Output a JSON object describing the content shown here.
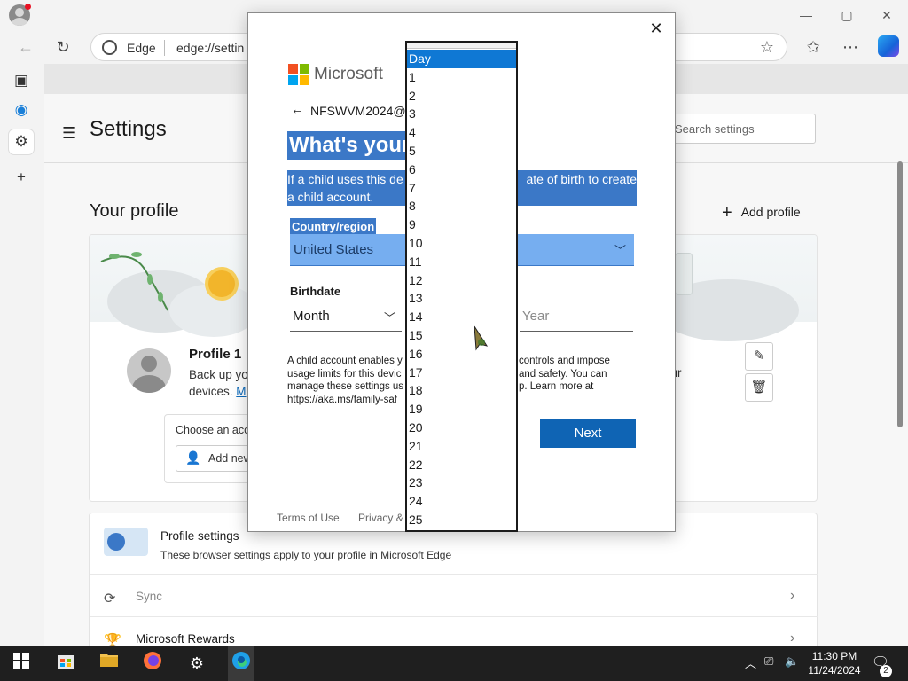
{
  "browser": {
    "address_site": "Edge",
    "address_url": "edge://settin",
    "window_controls": {
      "minimize": "—",
      "maximize": "▢",
      "close": "✕"
    }
  },
  "settings": {
    "title": "Settings",
    "search_placeholder": "Search settings",
    "your_profile": "Your profile",
    "add_profile": "Add profile",
    "profile": {
      "name": "Profile 1",
      "desc_line1": "Back up yo",
      "desc_line2": "devices.",
      "desc_link": "M",
      "desc_tail": "our",
      "choose_account_label": "Choose an acco",
      "add_new": "Add new"
    },
    "profile_settings_title": "Profile settings",
    "profile_settings_sub": "These browser settings apply to your profile in Microsoft Edge",
    "rows": [
      {
        "label": "Sync",
        "icon": "sync-icon"
      },
      {
        "label": "Microsoft Rewards",
        "icon": "trophy-icon"
      }
    ]
  },
  "dialog": {
    "brand": "Microsoft",
    "email": "NFSWVM2024@",
    "heading": "What's your",
    "desc_left_line1": "If a child uses this de",
    "desc_right_line1": "ate of birth to create",
    "desc_line2": "a child account.",
    "country_label": "Country/region",
    "country_value": "United States",
    "birthdate_label": "Birthdate",
    "month_placeholder": "Month",
    "year_placeholder": "Year",
    "info_left": [
      "A child account enables y",
      "usage limits for this devic",
      "manage these settings us",
      "https://aka.ms/family-saf"
    ],
    "info_right": [
      "controls and impose",
      "and safety. You can",
      "p. Learn more at",
      ""
    ],
    "next": "Next",
    "footer_terms": "Terms of Use",
    "footer_privacy": "Privacy & C"
  },
  "day_dropdown": {
    "selected": "Day",
    "options": [
      "1",
      "2",
      "3",
      "4",
      "5",
      "6",
      "7",
      "8",
      "9",
      "10",
      "11",
      "12",
      "13",
      "14",
      "15",
      "16",
      "17",
      "18",
      "19",
      "20",
      "21",
      "22",
      "23",
      "24",
      "25"
    ]
  },
  "taskbar": {
    "time": "11:30 PM",
    "date": "11/24/2024",
    "notifications": "2"
  },
  "colors": {
    "accent_blue": "#0f64b4",
    "selection_blue": "#3b78c7",
    "dropdown_highlight": "#0f78d4",
    "ms_red": "#f25022",
    "ms_green": "#7fba00",
    "ms_blue": "#00a4ef",
    "ms_yellow": "#ffb900"
  }
}
